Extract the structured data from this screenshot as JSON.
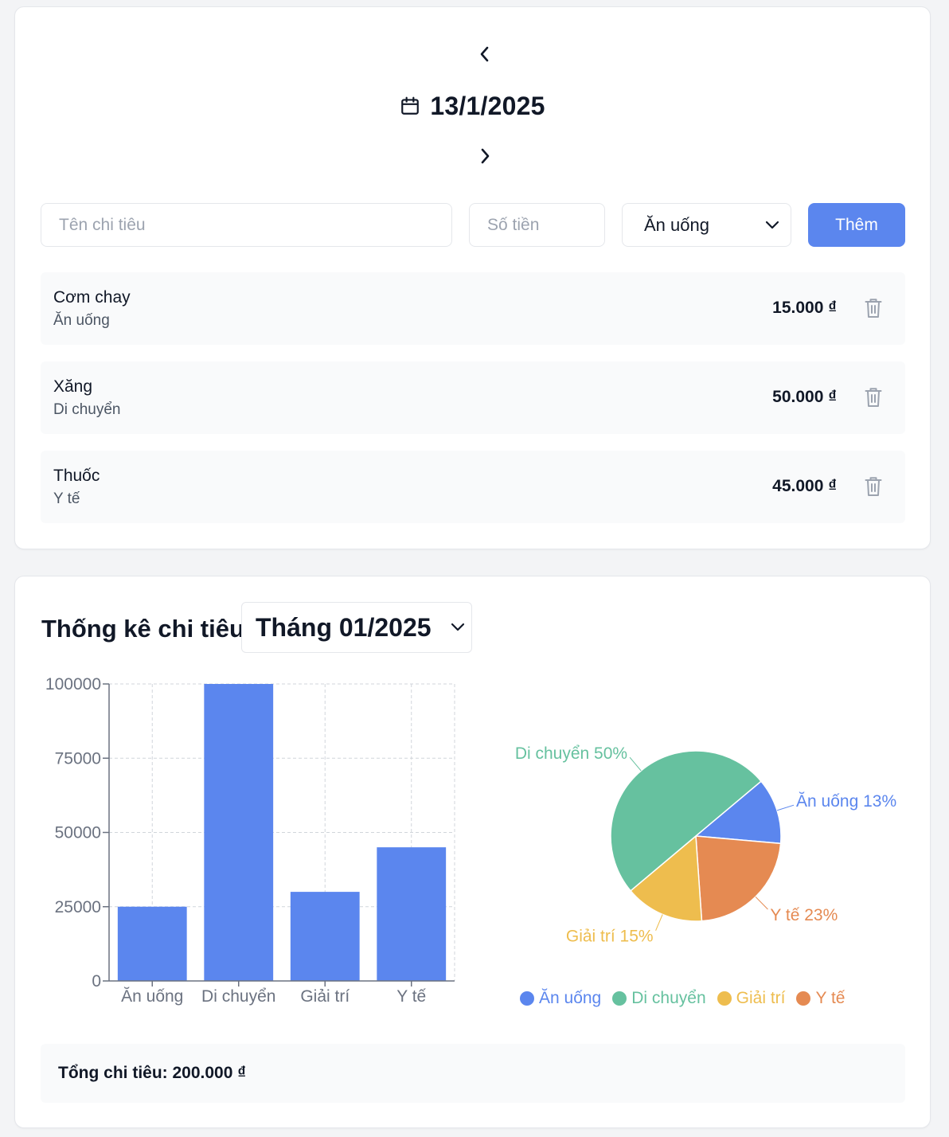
{
  "date_nav": {
    "date": "13/1/2025",
    "prev_icon": "chevron-left-icon",
    "next_icon": "chevron-right-icon",
    "calendar_icon": "calendar-icon"
  },
  "form": {
    "name_placeholder": "Tên chi tiêu",
    "amount_placeholder": "Số tiền",
    "category_selected": "Ăn uống",
    "add_label": "Thêm"
  },
  "expenses": [
    {
      "name": "Cơm chay",
      "category": "Ăn uống",
      "amount": "15.000 ₫"
    },
    {
      "name": "Xăng",
      "category": "Di chuyển",
      "amount": "50.000 ₫"
    },
    {
      "name": "Thuốc",
      "category": "Y tế",
      "amount": "45.000 ₫"
    }
  ],
  "stats": {
    "title": "Thống kê chi tiêu",
    "month_selected": "Tháng 01/2025",
    "total_label": "Tổng chi tiêu: 200.000 ₫"
  },
  "colors": {
    "accent": "#5b86ee",
    "an_uong": "#5b86ee",
    "di_chuyen": "#66c19f",
    "giai_tri": "#eebd4e",
    "y_te": "#e58a52"
  },
  "chart_data": [
    {
      "type": "bar",
      "categories": [
        "Ăn uống",
        "Di chuyển",
        "Giải trí",
        "Y tế"
      ],
      "values": [
        25000,
        100000,
        30000,
        45000
      ],
      "ylim": [
        0,
        100000
      ],
      "yticks": [
        "0",
        "25000",
        "50000",
        "75000",
        "100000"
      ],
      "grid": true,
      "color": "#5b86ee"
    },
    {
      "type": "pie",
      "labels": [
        "Ăn uống",
        "Di chuyển",
        "Giải trí",
        "Y tế"
      ],
      "values": [
        25000,
        100000,
        30000,
        45000
      ],
      "slice_labels": [
        "Ăn uống 13%",
        "Di chuyển 50%",
        "Giải trí 15%",
        "Y tế 23%"
      ],
      "colors": [
        "#5b86ee",
        "#66c19f",
        "#eebd4e",
        "#e58a52"
      ],
      "legend": "bottom"
    }
  ]
}
